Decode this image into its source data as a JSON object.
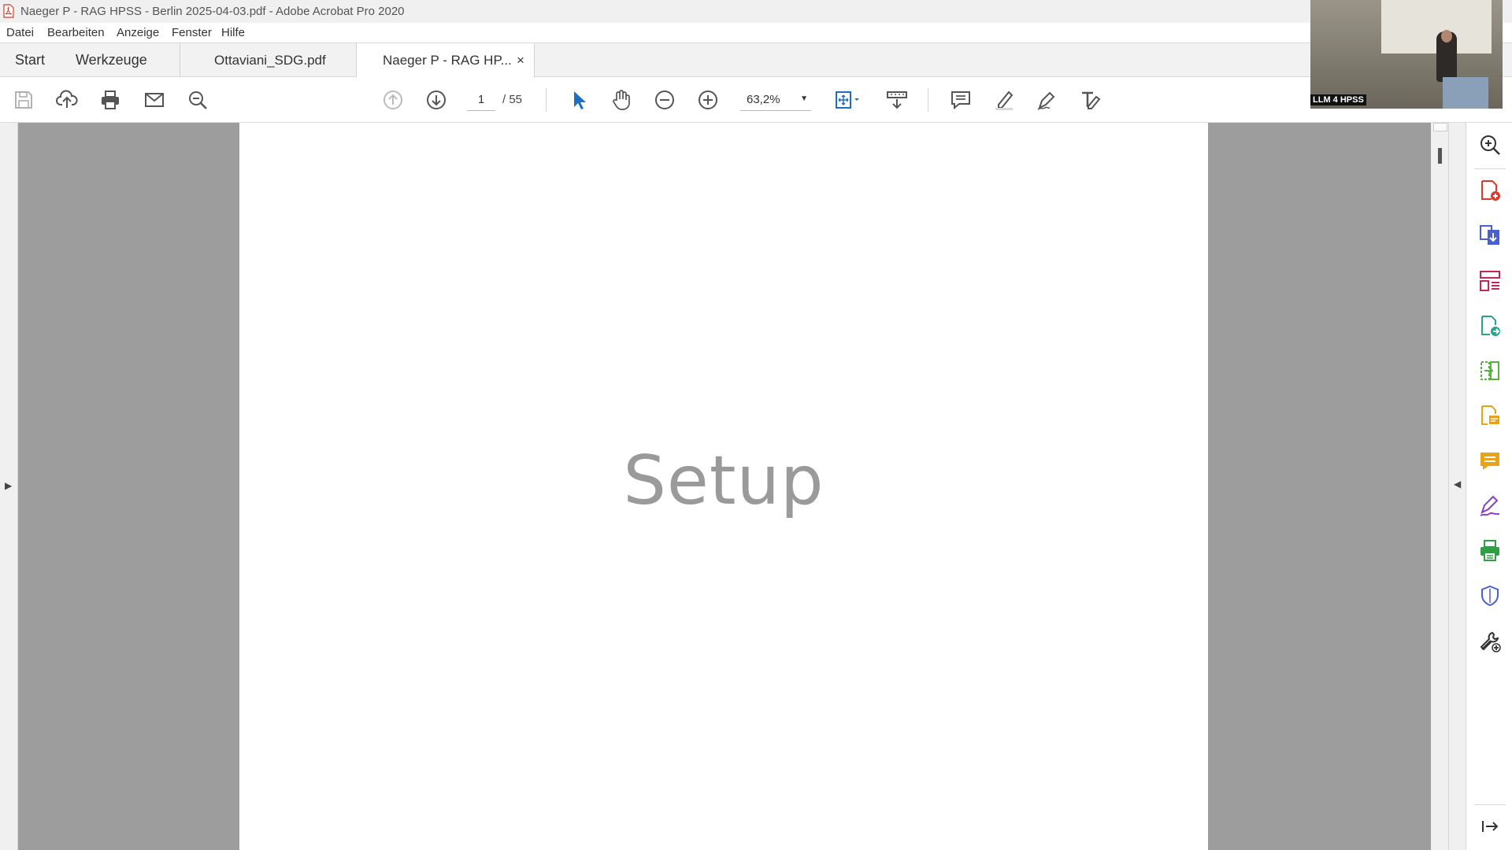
{
  "window": {
    "title": "Naeger P - RAG HPSS - Berlin 2025-04-03.pdf - Adobe Acrobat Pro 2020"
  },
  "menu": {
    "items": [
      "Datei",
      "Bearbeiten",
      "Anzeige",
      "Fenster",
      "Hilfe"
    ]
  },
  "tabs": {
    "start": "Start",
    "tools": "Werkzeuge",
    "doc1": "Ottaviani_SDG.pdf",
    "doc2": "Naeger P - RAG HP...",
    "close": "×"
  },
  "toolbar": {
    "page_current": "1",
    "page_total": "/ 55",
    "zoom": "63,2%"
  },
  "document": {
    "slide_title": "Setup"
  },
  "webcam": {
    "label": "LLM 4 HPSS"
  },
  "colors": {
    "acrobat_red": "#d83b2b",
    "tool_blue": "#1f6fbf",
    "page_bg": "#9d9d9d"
  },
  "icons": {
    "toolbar": [
      "save-icon",
      "upload-icon",
      "print-icon",
      "mail-icon",
      "search-icon",
      "page-up-icon",
      "page-down-icon",
      "select-arrow-icon",
      "hand-icon",
      "zoom-out-icon",
      "zoom-in-icon",
      "fit-page-icon",
      "scroll-mode-icon",
      "comment-icon",
      "highlight-icon",
      "sign-icon",
      "edit-icon"
    ],
    "right_pane": [
      "search-zoom-icon",
      "create-pdf-icon",
      "export-pdf-icon",
      "organize-pages-icon",
      "combine-files-icon",
      "compare-icon",
      "request-signature-icon",
      "comment-icon",
      "fill-sign-icon",
      "print-production-icon",
      "protect-icon",
      "more-tools-icon",
      "collapse-pane-icon"
    ]
  }
}
